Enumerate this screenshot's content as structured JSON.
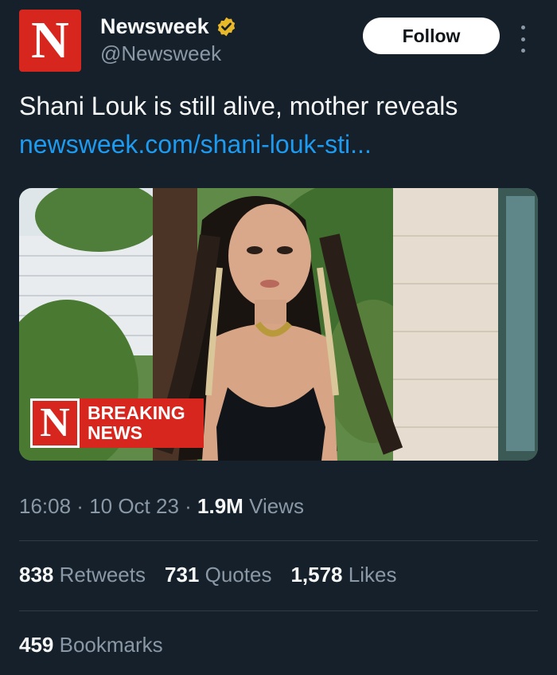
{
  "author": {
    "display_name": "Newsweek",
    "handle": "@Newsweek",
    "avatar_letter": "N",
    "avatar_color": "#d7261e",
    "verified_icon": "verified-gold-badge",
    "verified_color": "#e8b829"
  },
  "actions": {
    "follow_label": "Follow",
    "more_icon": "more-vertical-icon"
  },
  "tweet": {
    "text": "Shani Louk is still alive, mother reveals",
    "link_text": "newsweek.com/shani-louk-sti...",
    "link_color": "#1d9bf0"
  },
  "media": {
    "badge_letter": "N",
    "badge_line1": "BREAKING",
    "badge_line2": "NEWS"
  },
  "meta": {
    "time": "16:08",
    "sep1": " · ",
    "date": "10 Oct 23",
    "sep2": " · ",
    "views_count": "1.9M",
    "views_label": " Views"
  },
  "stats": {
    "retweets_count": "838",
    "retweets_label": " Retweets",
    "quotes_count": "731",
    "quotes_label": " Quotes",
    "likes_count": "1,578",
    "likes_label": " Likes",
    "bookmarks_count": "459",
    "bookmarks_label": " Bookmarks"
  },
  "colors": {
    "background": "#15202b",
    "primary_text": "#f7f9f9",
    "secondary_text": "#8b98a5"
  }
}
